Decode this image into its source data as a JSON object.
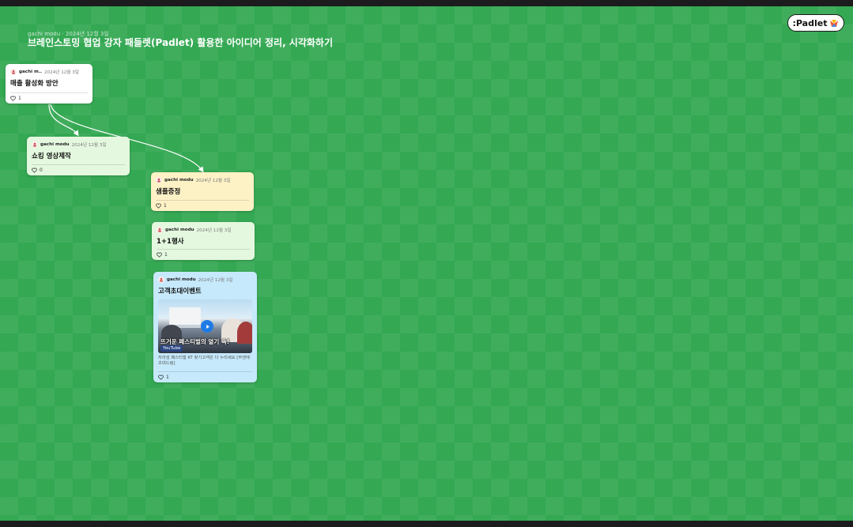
{
  "board": {
    "author": "gachi modu",
    "date": "2024년 12월 3일",
    "title": "브레인스토밍 협업 강자 패들렛(Padlet) 활용한 아이디어 정리, 시각화하기",
    "logo_text": ":Padlet",
    "background_color": "#34a853"
  },
  "posts": [
    {
      "author": "gachi m..",
      "date": "2024년 12월 3일",
      "title": "매출 활성화 방안",
      "likes": "1",
      "color": "#ffffff"
    },
    {
      "author": "gachi modu",
      "date": "2024년 12월 3일",
      "title": "쇼킹 영상제작",
      "likes": "0",
      "color": "#e4f8df"
    },
    {
      "author": "gachi modu",
      "date": "2024년 12월 3일",
      "title": "샘플증정",
      "likes": "1",
      "color": "#fdf1c6"
    },
    {
      "author": "gachi modu",
      "date": "2024년 12월 3일",
      "title": "1+1행사",
      "likes": "1",
      "color": "#e4f8df"
    },
    {
      "author": "gachi modu",
      "date": "2024년 12월 3일",
      "title": "고객초대이벤트",
      "likes": "1",
      "color": "#c6e9fb",
      "attachment": {
        "caption": "뜨거운 페스티벌의 열기 속!",
        "source": "YouTube",
        "description": "자라섬 페스티벌 KT 찾기고객은 다 누리세요 [무엔에 초대드림]"
      }
    }
  ],
  "icons": {
    "heart": "heart-icon",
    "avatar": "avatar-icon",
    "play": "play-icon",
    "logo_mark": "padlet-logo-icon"
  }
}
